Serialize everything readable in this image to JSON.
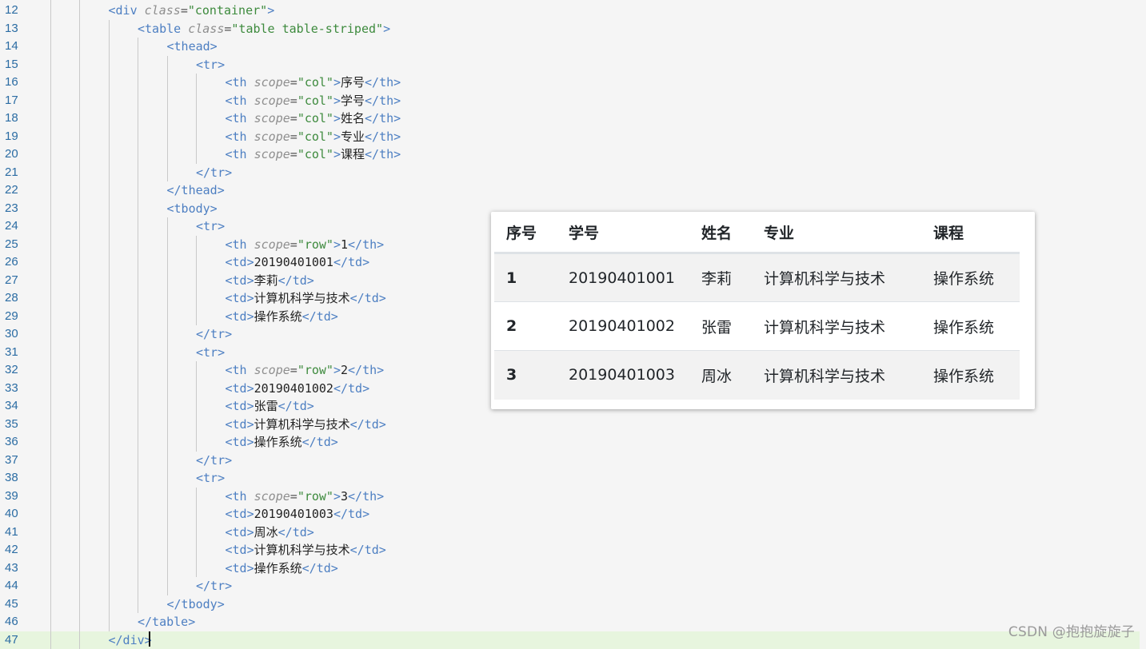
{
  "editor": {
    "lines": [
      {
        "n": "12",
        "indent": 3,
        "tokens": [
          [
            "tag",
            "<div"
          ],
          [
            "sp",
            " "
          ],
          [
            "attr",
            "class"
          ],
          [
            "eq",
            "="
          ],
          [
            "str",
            "\"container\""
          ],
          [
            "tag",
            ">"
          ]
        ]
      },
      {
        "n": "13",
        "indent": 4,
        "tokens": [
          [
            "tag",
            "<table"
          ],
          [
            "sp",
            " "
          ],
          [
            "attr",
            "class"
          ],
          [
            "eq",
            "="
          ],
          [
            "str",
            "\"table table-striped\""
          ],
          [
            "tag",
            ">"
          ]
        ]
      },
      {
        "n": "14",
        "indent": 5,
        "tokens": [
          [
            "tag",
            "<thead>"
          ]
        ]
      },
      {
        "n": "15",
        "indent": 6,
        "tokens": [
          [
            "tag",
            "<tr>"
          ]
        ]
      },
      {
        "n": "16",
        "indent": 7,
        "tokens": [
          [
            "tag",
            "<th"
          ],
          [
            "sp",
            " "
          ],
          [
            "attr",
            "scope"
          ],
          [
            "eq",
            "="
          ],
          [
            "str",
            "\"col\""
          ],
          [
            "tag",
            ">"
          ],
          [
            "text",
            "序号"
          ],
          [
            "tag",
            "</th>"
          ]
        ]
      },
      {
        "n": "17",
        "indent": 7,
        "tokens": [
          [
            "tag",
            "<th"
          ],
          [
            "sp",
            " "
          ],
          [
            "attr",
            "scope"
          ],
          [
            "eq",
            "="
          ],
          [
            "str",
            "\"col\""
          ],
          [
            "tag",
            ">"
          ],
          [
            "text",
            "学号"
          ],
          [
            "tag",
            "</th>"
          ]
        ]
      },
      {
        "n": "18",
        "indent": 7,
        "tokens": [
          [
            "tag",
            "<th"
          ],
          [
            "sp",
            " "
          ],
          [
            "attr",
            "scope"
          ],
          [
            "eq",
            "="
          ],
          [
            "str",
            "\"col\""
          ],
          [
            "tag",
            ">"
          ],
          [
            "text",
            "姓名"
          ],
          [
            "tag",
            "</th>"
          ]
        ]
      },
      {
        "n": "19",
        "indent": 7,
        "tokens": [
          [
            "tag",
            "<th"
          ],
          [
            "sp",
            " "
          ],
          [
            "attr",
            "scope"
          ],
          [
            "eq",
            "="
          ],
          [
            "str",
            "\"col\""
          ],
          [
            "tag",
            ">"
          ],
          [
            "text",
            "专业"
          ],
          [
            "tag",
            "</th>"
          ]
        ]
      },
      {
        "n": "20",
        "indent": 7,
        "tokens": [
          [
            "tag",
            "<th"
          ],
          [
            "sp",
            " "
          ],
          [
            "attr",
            "scope"
          ],
          [
            "eq",
            "="
          ],
          [
            "str",
            "\"col\""
          ],
          [
            "tag",
            ">"
          ],
          [
            "text",
            "课程"
          ],
          [
            "tag",
            "</th>"
          ]
        ]
      },
      {
        "n": "21",
        "indent": 6,
        "tokens": [
          [
            "tag",
            "</tr>"
          ]
        ]
      },
      {
        "n": "22",
        "indent": 5,
        "tokens": [
          [
            "tag",
            "</thead>"
          ]
        ]
      },
      {
        "n": "23",
        "indent": 5,
        "tokens": [
          [
            "tag",
            "<tbody>"
          ]
        ]
      },
      {
        "n": "24",
        "indent": 6,
        "tokens": [
          [
            "tag",
            "<tr>"
          ]
        ]
      },
      {
        "n": "25",
        "indent": 7,
        "tokens": [
          [
            "tag",
            "<th"
          ],
          [
            "sp",
            " "
          ],
          [
            "attr",
            "scope"
          ],
          [
            "eq",
            "="
          ],
          [
            "str",
            "\"row\""
          ],
          [
            "tag",
            ">"
          ],
          [
            "text",
            "1"
          ],
          [
            "tag",
            "</th>"
          ]
        ]
      },
      {
        "n": "26",
        "indent": 7,
        "tokens": [
          [
            "tag",
            "<td>"
          ],
          [
            "text",
            "20190401001"
          ],
          [
            "tag",
            "</td>"
          ]
        ]
      },
      {
        "n": "27",
        "indent": 7,
        "tokens": [
          [
            "tag",
            "<td>"
          ],
          [
            "text",
            "李莉"
          ],
          [
            "tag",
            "</td>"
          ]
        ]
      },
      {
        "n": "28",
        "indent": 7,
        "tokens": [
          [
            "tag",
            "<td>"
          ],
          [
            "text",
            "计算机科学与技术"
          ],
          [
            "tag",
            "</td>"
          ]
        ]
      },
      {
        "n": "29",
        "indent": 7,
        "tokens": [
          [
            "tag",
            "<td>"
          ],
          [
            "text",
            "操作系统"
          ],
          [
            "tag",
            "</td>"
          ]
        ]
      },
      {
        "n": "30",
        "indent": 6,
        "tokens": [
          [
            "tag",
            "</tr>"
          ]
        ]
      },
      {
        "n": "31",
        "indent": 6,
        "tokens": [
          [
            "tag",
            "<tr>"
          ]
        ]
      },
      {
        "n": "32",
        "indent": 7,
        "tokens": [
          [
            "tag",
            "<th"
          ],
          [
            "sp",
            " "
          ],
          [
            "attr",
            "scope"
          ],
          [
            "eq",
            "="
          ],
          [
            "str",
            "\"row\""
          ],
          [
            "tag",
            ">"
          ],
          [
            "text",
            "2"
          ],
          [
            "tag",
            "</th>"
          ]
        ]
      },
      {
        "n": "33",
        "indent": 7,
        "tokens": [
          [
            "tag",
            "<td>"
          ],
          [
            "text",
            "20190401002"
          ],
          [
            "tag",
            "</td>"
          ]
        ]
      },
      {
        "n": "34",
        "indent": 7,
        "tokens": [
          [
            "tag",
            "<td>"
          ],
          [
            "text",
            "张雷"
          ],
          [
            "tag",
            "</td>"
          ]
        ]
      },
      {
        "n": "35",
        "indent": 7,
        "tokens": [
          [
            "tag",
            "<td>"
          ],
          [
            "text",
            "计算机科学与技术"
          ],
          [
            "tag",
            "</td>"
          ]
        ]
      },
      {
        "n": "36",
        "indent": 7,
        "tokens": [
          [
            "tag",
            "<td>"
          ],
          [
            "text",
            "操作系统"
          ],
          [
            "tag",
            "</td>"
          ]
        ]
      },
      {
        "n": "37",
        "indent": 6,
        "tokens": [
          [
            "tag",
            "</tr>"
          ]
        ]
      },
      {
        "n": "38",
        "indent": 6,
        "tokens": [
          [
            "tag",
            "<tr>"
          ]
        ]
      },
      {
        "n": "39",
        "indent": 7,
        "tokens": [
          [
            "tag",
            "<th"
          ],
          [
            "sp",
            " "
          ],
          [
            "attr",
            "scope"
          ],
          [
            "eq",
            "="
          ],
          [
            "str",
            "\"row\""
          ],
          [
            "tag",
            ">"
          ],
          [
            "text",
            "3"
          ],
          [
            "tag",
            "</th>"
          ]
        ]
      },
      {
        "n": "40",
        "indent": 7,
        "tokens": [
          [
            "tag",
            "<td>"
          ],
          [
            "text",
            "20190401003"
          ],
          [
            "tag",
            "</td>"
          ]
        ]
      },
      {
        "n": "41",
        "indent": 7,
        "tokens": [
          [
            "tag",
            "<td>"
          ],
          [
            "text",
            "周冰"
          ],
          [
            "tag",
            "</td>"
          ]
        ]
      },
      {
        "n": "42",
        "indent": 7,
        "tokens": [
          [
            "tag",
            "<td>"
          ],
          [
            "text",
            "计算机科学与技术"
          ],
          [
            "tag",
            "</td>"
          ]
        ]
      },
      {
        "n": "43",
        "indent": 7,
        "tokens": [
          [
            "tag",
            "<td>"
          ],
          [
            "text",
            "操作系统"
          ],
          [
            "tag",
            "</td>"
          ]
        ]
      },
      {
        "n": "44",
        "indent": 6,
        "tokens": [
          [
            "tag",
            "</tr>"
          ]
        ]
      },
      {
        "n": "45",
        "indent": 5,
        "tokens": [
          [
            "tag",
            "</tbody>"
          ]
        ]
      },
      {
        "n": "46",
        "indent": 4,
        "tokens": [
          [
            "tag",
            "</table>"
          ]
        ]
      },
      {
        "n": "47",
        "indent": 3,
        "tokens": [
          [
            "tag",
            "</div>"
          ]
        ],
        "active": true
      }
    ]
  },
  "preview": {
    "headers": [
      "序号",
      "学号",
      "姓名",
      "专业",
      "课程"
    ],
    "rows": [
      {
        "index": "1",
        "id": "20190401001",
        "name": "李莉",
        "major": "计算机科学与技术",
        "course": "操作系统"
      },
      {
        "index": "2",
        "id": "20190401002",
        "name": "张雷",
        "major": "计算机科学与技术",
        "course": "操作系统"
      },
      {
        "index": "3",
        "id": "20190401003",
        "name": "周冰",
        "major": "计算机科学与技术",
        "course": "操作系统"
      }
    ]
  },
  "watermark": "CSDN @抱抱旋旋子",
  "colors": {
    "tag": "#4d7fc2",
    "attribute": "#8e8e8e",
    "string": "#3d8a3d",
    "text": "#222222",
    "line_number": "#2b6ca3",
    "active_line": "#e7f5de",
    "stripe": "#f2f2f2"
  }
}
